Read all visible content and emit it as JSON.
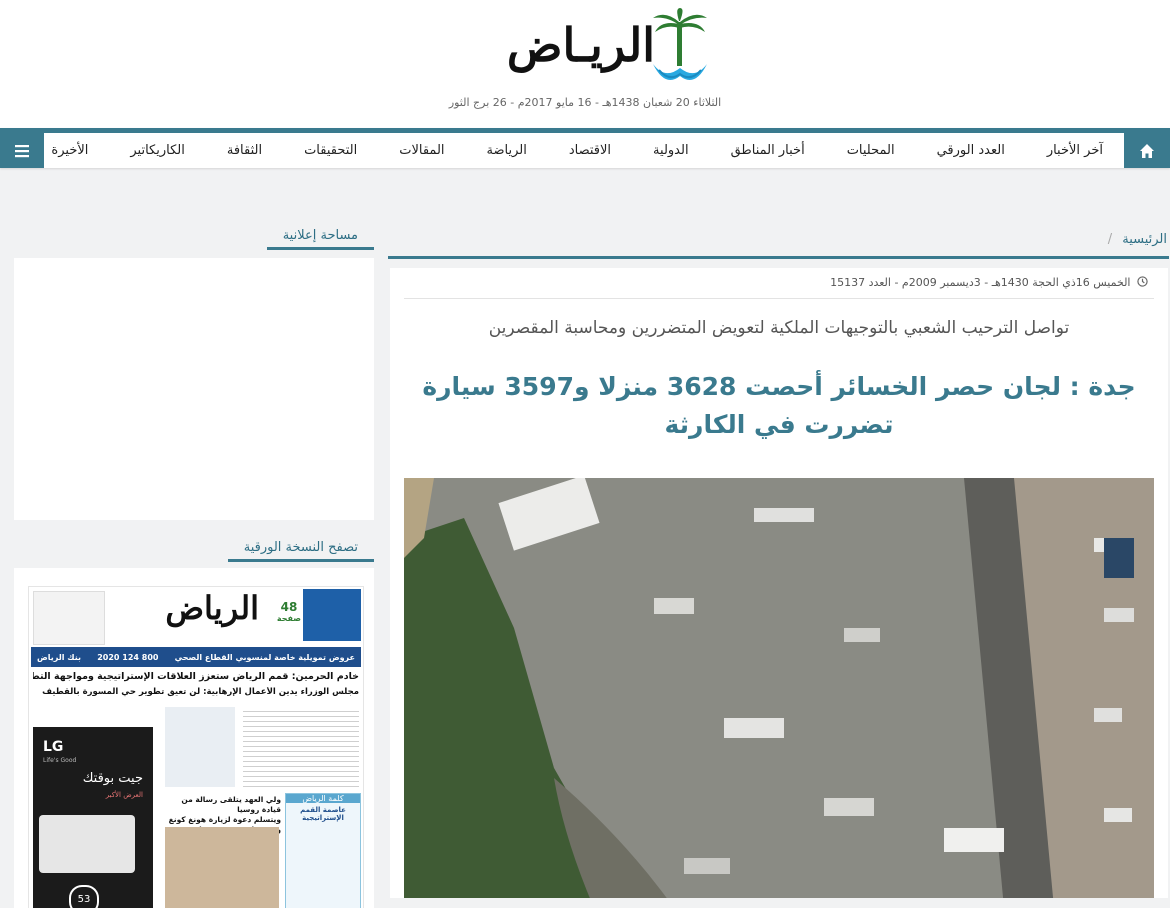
{
  "header": {
    "logo_text": "الريـاض",
    "date": "الثلاثاء 20 شعبان 1438هـ - 16 مايو 2017م - 26 برج الثور"
  },
  "nav": {
    "home_icon": "home-icon",
    "menu_icon": "hamburger-menu-icon",
    "items": [
      "آخر الأخبار",
      "العدد الورقي",
      "المحليات",
      "أخبار المناطق",
      "الدولية",
      "الاقتصاد",
      "الرياضة",
      "المقالات",
      "التحقيقات",
      "الثقافة",
      "الكاريكاتير",
      "الأخيرة"
    ]
  },
  "breadcrumb": {
    "home": "الرئيسية",
    "separator": "/"
  },
  "article": {
    "meta": "الخميس 16ذي الحجة 1430هـ - 3ديسمبر 2009م - العدد 15137",
    "clock_icon": "clock-icon",
    "subtitle": "تواصل الترحيب الشعبي بالتوجيهات الملكية لتعويض المتضررين ومحاسبة المقصرين",
    "headline": "جدة : لجان حصر الخسائر أحصت 3628 منزلا و3597 سيارة تضررت في الكارثة"
  },
  "sidebar": {
    "ad_title": "مساحة إعلانية",
    "paper_title": "تصفح النسخة الورقية",
    "paper": {
      "logo": "الرياض",
      "pages_num": "48",
      "pages_label": "صفحة",
      "banner": "عروض تمويلية خاصة لمنسوبي القطاع الصحي",
      "bank": "بنك الرياض",
      "bank_phone": "800 124 2020",
      "lead1": "خادم الحرمين: قمم الرياض ستعزز العلاقات الإستراتيجية ومواجهة التطرف",
      "lead2": "مجلس الوزراء يدين الأعمال الإرهابية: لن تعيق تطوير حي المسورة بالقطيف",
      "ad_brand": "LG",
      "ad_tagline": "Life's Good",
      "ad_text": "جيت بوقتك",
      "ad_sub": "العرض الأكبر",
      "col_title": "كلمة الرياض",
      "col_head": "عاصمة القمم الإستراتيجية",
      "story": "ولي العهد يتلقى رسالة من قيادة روسيا",
      "story2": "ويتسلم دعوة لزيارة هونغ كونغ ويستقبل سفير فرنسا",
      "badge": "53"
    }
  },
  "colors": {
    "accent": "#3a7a8e",
    "background": "#f1f2f3"
  }
}
